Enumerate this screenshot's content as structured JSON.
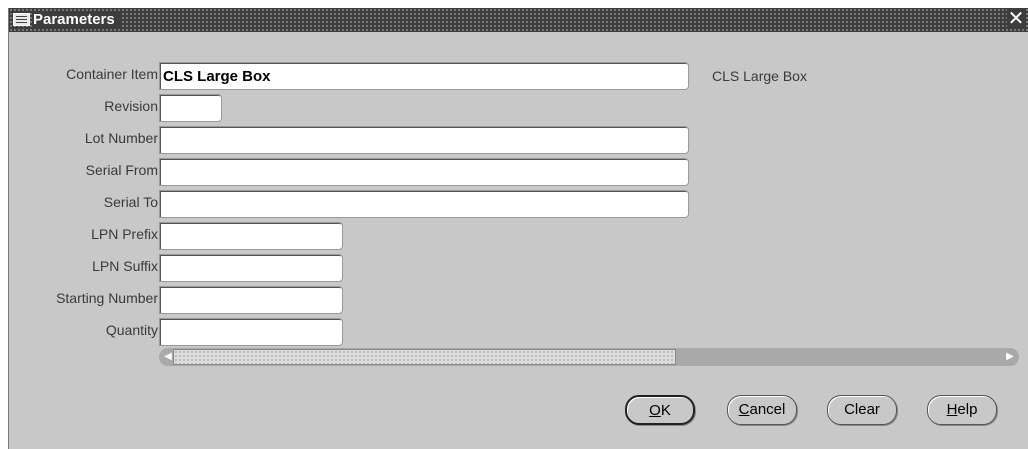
{
  "window": {
    "title": "Parameters",
    "close_glyph": "✕"
  },
  "form": {
    "container_item_label": "Container Item",
    "container_item_value": "CLS Large Box",
    "container_item_description": "CLS Large Box",
    "revision_label": "Revision",
    "revision_value": "",
    "lot_number_label": "Lot Number",
    "lot_number_value": "",
    "serial_from_label": "Serial From",
    "serial_from_value": "",
    "serial_to_label": "Serial To",
    "serial_to_value": "",
    "lpn_prefix_label": "LPN Prefix",
    "lpn_prefix_value": "",
    "lpn_suffix_label": "LPN Suffix",
    "lpn_suffix_value": "",
    "starting_number_label": "Starting Number",
    "starting_number_value": "",
    "quantity_label": "Quantity",
    "quantity_value": ""
  },
  "buttons": {
    "ok": {
      "mnemonic": "O",
      "rest": "K"
    },
    "cancel": {
      "mnemonic": "C",
      "rest": "ancel"
    },
    "clear": {
      "label": "Clear"
    },
    "help": {
      "mnemonic": "H",
      "rest": "elp"
    }
  },
  "icons": {
    "title": "oracle-app-icon",
    "close": "close-icon",
    "scroll_left": "scroll-left-arrow-icon",
    "scroll_right": "scroll-right-arrow-icon"
  },
  "colors": {
    "window_bg": "#c8c8c8",
    "titlebar_bg": "#3d3d3d",
    "field_bg": "#ffffff",
    "scroll_track": "#a9a9a9"
  }
}
